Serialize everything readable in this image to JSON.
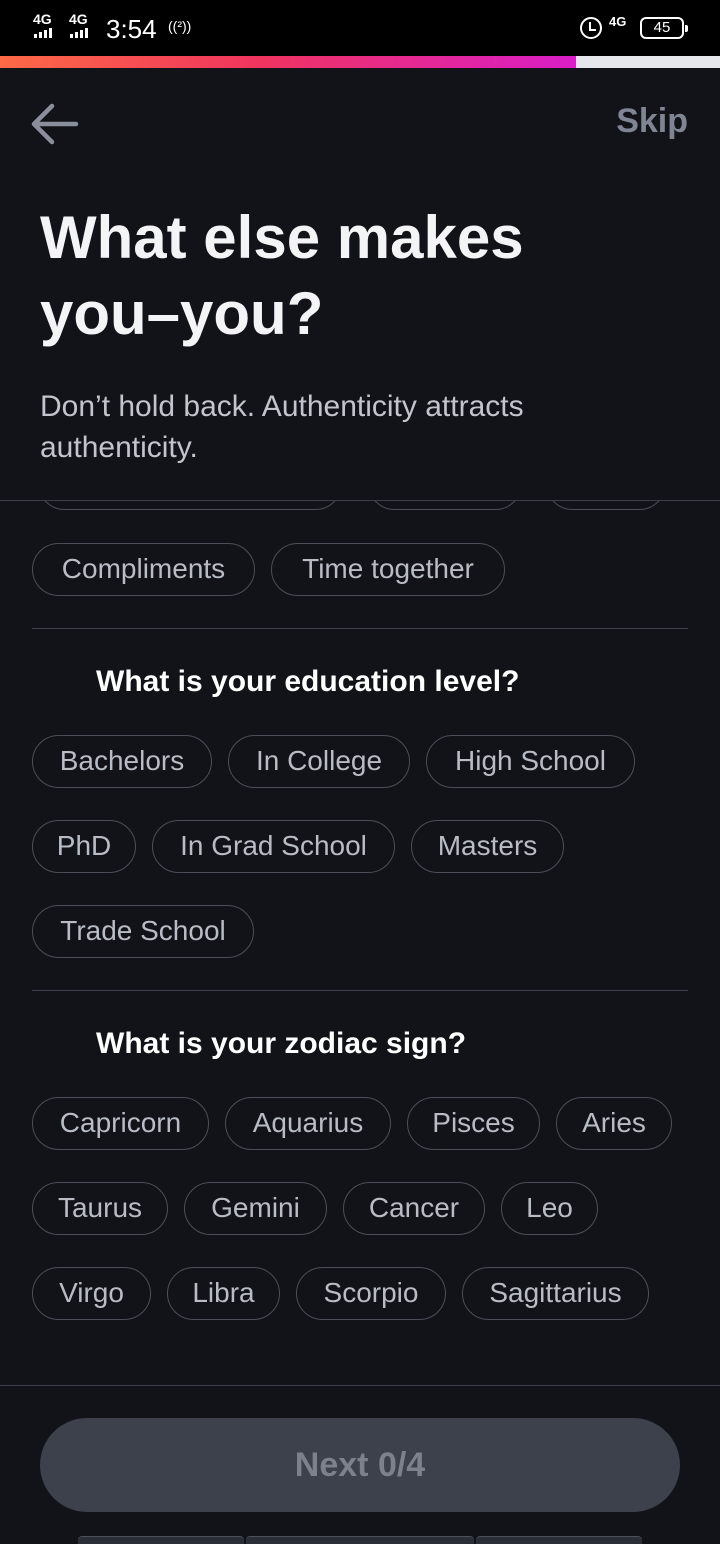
{
  "status_bar": {
    "network_1": "4G",
    "network_2": "4G",
    "time": "3:54",
    "hotspot_glyph": "((²))",
    "network_3": "4G",
    "battery": "45",
    "icons": [
      "signal-icon",
      "hotspot-icon",
      "alarm-icon",
      "battery-icon"
    ]
  },
  "progress": {
    "fraction": 0.8,
    "colors": [
      "#fd6a45",
      "#f0345f",
      "#d91ec8"
    ]
  },
  "header": {
    "back_icon": "arrow-left-icon",
    "skip_label": "Skip",
    "title": "What else makes you–you?",
    "subtitle": "Don’t hold back. Authenticity attracts authenticity."
  },
  "sections": {
    "love_language": {
      "options": [
        "Compliments",
        "Time together"
      ]
    },
    "education": {
      "title": "What is your education level?",
      "options": [
        "Bachelors",
        "In College",
        "High School",
        "PhD",
        "In Grad School",
        "Masters",
        "Trade School"
      ]
    },
    "zodiac": {
      "title": "What is your zodiac sign?",
      "options": [
        "Capricorn",
        "Aquarius",
        "Pisces",
        "Aries",
        "Taurus",
        "Gemini",
        "Cancer",
        "Leo",
        "Virgo",
        "Libra",
        "Scorpio",
        "Sagittarius"
      ]
    }
  },
  "footer": {
    "next_label": "Next 0/4",
    "selected": 0,
    "max": 4
  }
}
